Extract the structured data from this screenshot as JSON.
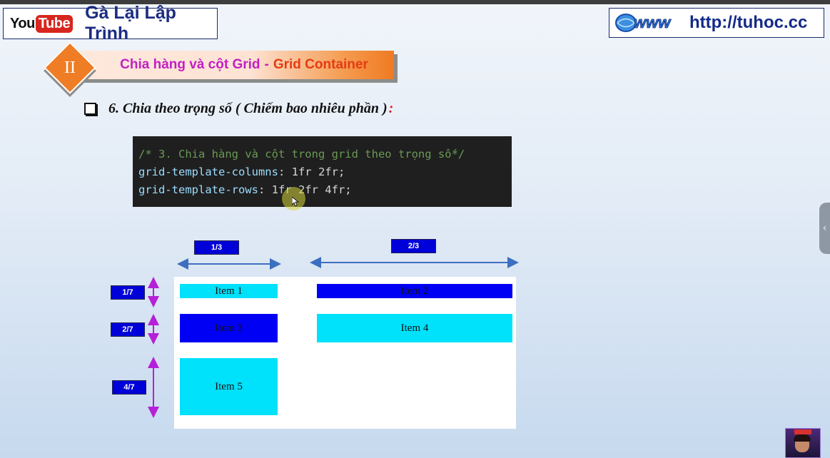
{
  "header": {
    "logo_you": "You",
    "logo_tube": "Tube",
    "channel_name": "Gà Lại Lập Trình",
    "www_icon": "www-globe-icon",
    "website_url": "http://tuhoc.cc"
  },
  "section": {
    "roman": "II",
    "title_part1": "Chia hàng và cột Grid",
    "title_sep": "-",
    "title_part2": "Grid Container"
  },
  "heading": {
    "text": "6. Chia theo trọng số ( Chiếm bao nhiêu phần )",
    "colon": ":"
  },
  "code": {
    "comment": "/* 3. Chia hàng và cột trong grid theo trọng số*/",
    "line2_prop": "grid-template-columns",
    "line2_value": ": 1fr 2fr;",
    "line3_prop": "grid-template-rows",
    "line3_value": ": 1fr 2fr 4fr;"
  },
  "diagram": {
    "col_labels": [
      "1/3",
      "2/3"
    ],
    "row_labels": [
      "1/7",
      "2/7",
      "4/7"
    ],
    "items": [
      "Item 1",
      "Item 2",
      "Item 3",
      "Item 4",
      "Item 5"
    ]
  },
  "colors": {
    "cyan_item": "#00e1fb",
    "blue_item": "#0000f4",
    "label_bg": "#0000d8",
    "horizontal_arrow": "#3d6fc0",
    "vertical_arrow": "#b620d8"
  },
  "side_panel": {
    "handle_icon": "chevron-left-icon"
  }
}
